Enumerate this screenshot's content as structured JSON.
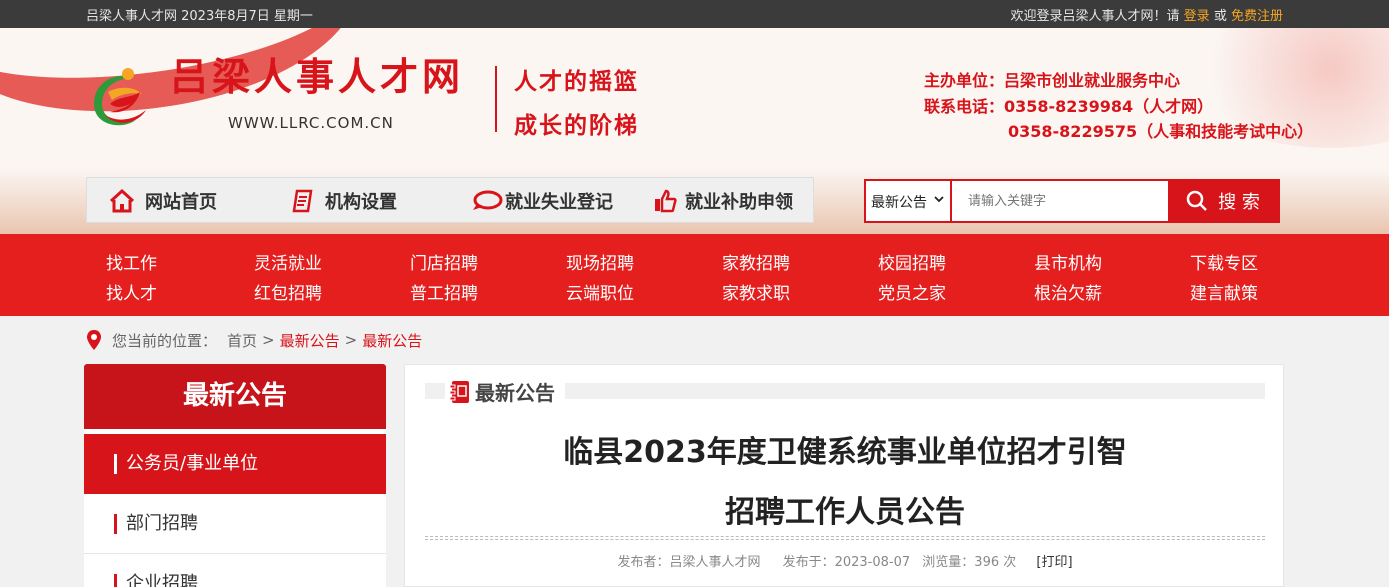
{
  "topbar": {
    "date": "吕梁人事人才网 2023年8月7日 星期一",
    "welcome": "欢迎登录吕梁人事人才网！请",
    "login": "登录",
    "or": "或",
    "register": "免费注册"
  },
  "header": {
    "site_name": "吕梁人事人才网",
    "site_url": "WWW.LLRC.COM.CN",
    "slogan_1": "人才的摇篮",
    "slogan_2": "成长的阶梯",
    "host": "主办单位：吕梁市创业就业服务中心",
    "phone_1": "联系电话：0358-8239984（人才网）",
    "phone_2": "0358-8229575（人事和技能考试中心）"
  },
  "graynav": [
    {
      "label": "网站首页",
      "icon": "home-icon"
    },
    {
      "label": "机构设置",
      "icon": "document-icon"
    },
    {
      "label": "就业失业登记",
      "icon": "chat-icon"
    },
    {
      "label": "就业补助申领",
      "icon": "thumbs-up-icon"
    }
  ],
  "search": {
    "select_value": "最新公告",
    "placeholder": "请输入关键字",
    "button": "搜 索"
  },
  "rednav": {
    "row1": [
      "找工作",
      "灵活就业",
      "门店招聘",
      "现场招聘",
      "家教招聘",
      "校园招聘",
      "县市机构",
      "下载专区"
    ],
    "row2": [
      "找人才",
      "红包招聘",
      "普工招聘",
      "云端职位",
      "家教求职",
      "党员之家",
      "根治欠薪",
      "建言献策"
    ]
  },
  "breadcrumb": {
    "prefix": "您当前的位置：",
    "home": "首页",
    "level1": "最新公告",
    "level2": "最新公告",
    "sep": ">"
  },
  "sidebar": {
    "title": "最新公告",
    "items": [
      "公务员/事业单位",
      "部门招聘",
      "企业招聘"
    ]
  },
  "main": {
    "section_title": "最新公告",
    "title_line_1": "临县2023年度卫健系统事业单位招才引智",
    "title_line_2": "招聘工作人员公告",
    "publisher": "发布者：吕梁人事人才网",
    "published": "发布于：2023-08-07",
    "views": "浏览量：396 次",
    "print": "[打印]"
  },
  "colors": {
    "brand_red": "#d8141b",
    "nav_red": "#e51e1e",
    "topbar": "#3b3b3b",
    "accent_orange": "#f5a623"
  }
}
